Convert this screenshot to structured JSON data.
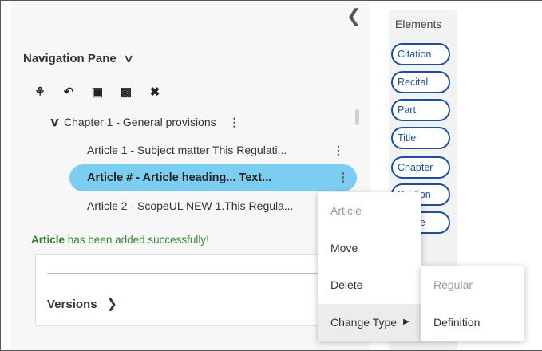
{
  "nav_pane": {
    "title": "Navigation Pane",
    "collapse_icon": "chevron-left-icon",
    "toolbar": [
      "hierarchy-icon",
      "undo-icon",
      "move-up-icon",
      "move-down-icon",
      "close-icon"
    ],
    "chapter_label": "Chapter 1 - General provisions",
    "articles": [
      "Article 1 - Subject matter This Regulati...",
      "Article # - Article heading... Text...",
      "Article 2 - ScopeUL NEW 1.This Regula..."
    ],
    "success_bold": "Article",
    "success_rest": " has been added successfully!",
    "versions_label": "Versions"
  },
  "elements": {
    "title": "Elements",
    "items": [
      "Citation",
      "Recital",
      "Part",
      "Title",
      "Chapter",
      "Section",
      "Article"
    ]
  },
  "context_menu": {
    "header": "Article",
    "items": [
      "Move",
      "Delete",
      "Change Type"
    ]
  },
  "submenu": {
    "header": "Regular",
    "items": [
      "Definition"
    ]
  },
  "colors": {
    "selected_row": "#7ccdf2",
    "pill_border": "#1d4f9c",
    "success": "#3a8a3a"
  }
}
